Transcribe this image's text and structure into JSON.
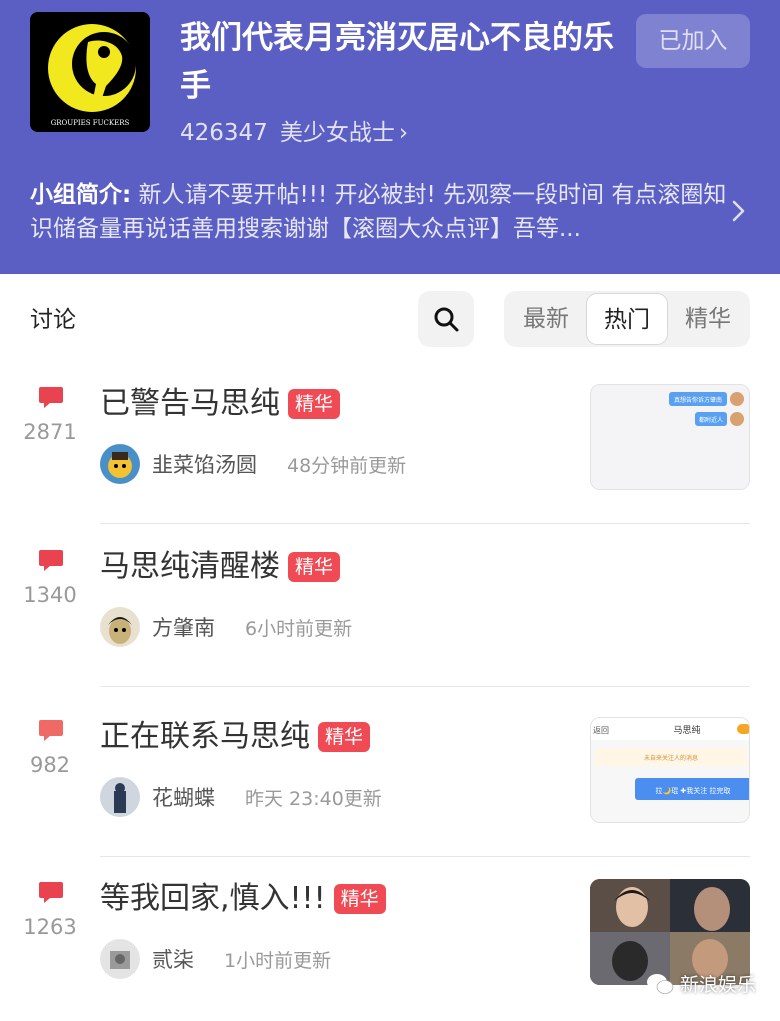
{
  "group": {
    "title": "我们代表月亮消灭居心不良的乐手",
    "join_label": "已加入",
    "member_count": "426347",
    "member_label": "美少女战士",
    "chevron": "›",
    "logo_text": "GROUPIES FUCKERS",
    "intro_label": "小组简介:",
    "intro_text": "新人请不要开帖!!! 开必被封! 先观察一段时间 有点滚圈知识储备量再说话善用搜索谢谢【滚圈大众点评】吾等...",
    "colors": {
      "header_bg": "#5b5fc4",
      "badge": "#f04a55",
      "comment_icon": "#e8434e"
    }
  },
  "toolbar": {
    "section_label": "讨论",
    "search_icon": "search-icon",
    "tabs": [
      "最新",
      "热门",
      "精华"
    ],
    "active_tab": "热门"
  },
  "posts": [
    {
      "title": "已警告马思纯",
      "badge": "精华",
      "count": "2871",
      "author": "韭菜馅汤圆",
      "time": "48分钟前更新",
      "thumb": "chat"
    },
    {
      "title": "马思纯清醒楼",
      "badge": "精华",
      "count": "1340",
      "author": "方肇南",
      "time": "6小时前更新",
      "thumb": ""
    },
    {
      "title": "正在联系马思纯",
      "badge": "精华",
      "count": "982",
      "author": "花蝴蝶",
      "time": "昨天 23:40更新",
      "thumb": "profile"
    },
    {
      "title": "等我回家,慎入!!!",
      "badge": "精华",
      "count": "1263",
      "author": "贰柒",
      "time": "1小时前更新",
      "thumb": "photo"
    }
  ],
  "thumbs": {
    "chat_bubble_1": "真想告你诉方肇南",
    "chat_bubble_2": "都附近人",
    "profile_back": "返回",
    "profile_name": "马思纯",
    "profile_note": "未自来关注人的消息",
    "profile_action": "拉🌙琨 ✚我关注 拉完取"
  },
  "watermark": {
    "text": "新浪娱乐",
    "icon": "wechat-icon"
  }
}
